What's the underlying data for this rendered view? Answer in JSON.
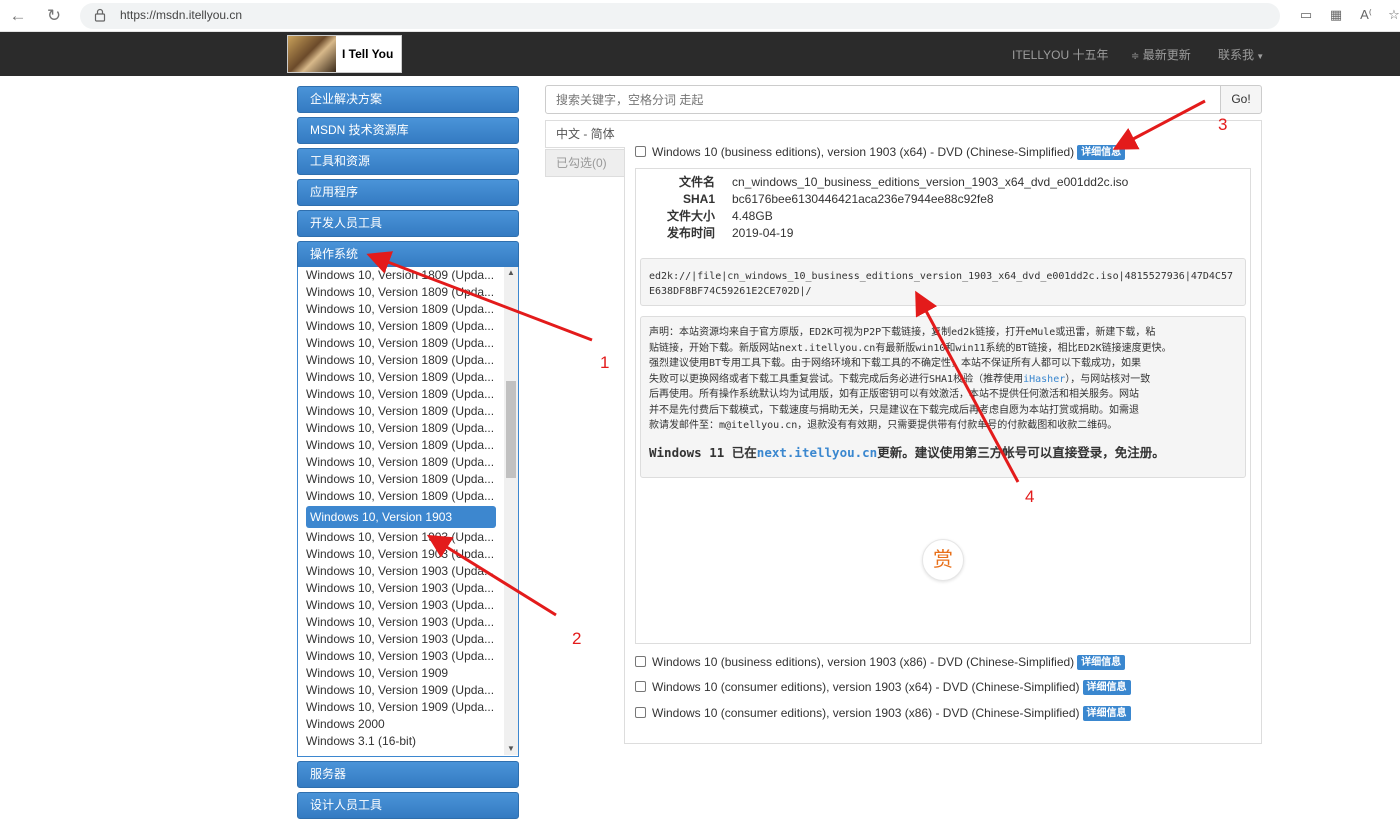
{
  "browser": {
    "url": "https://msdn.itellyou.cn"
  },
  "navbar": {
    "logo_text": "I Tell You",
    "links": [
      "ITELLYOU 十五年",
      "最新更新",
      "联系我"
    ]
  },
  "sidebar": {
    "top_items": [
      "企业解决方案",
      "MSDN 技术资源库",
      "工具和资源",
      "应用程序",
      "开发人员工具",
      "操作系统"
    ],
    "os_list": [
      "Windows 10, Version 1809 (Upda...",
      "Windows 10, Version 1809 (Upda...",
      "Windows 10, Version 1809 (Upda...",
      "Windows 10, Version 1809 (Upda...",
      "Windows 10, Version 1809 (Upda...",
      "Windows 10, Version 1809 (Upda...",
      "Windows 10, Version 1809 (Upda...",
      "Windows 10, Version 1809 (Upda...",
      "Windows 10, Version 1809 (Upda...",
      "Windows 10, Version 1809 (Upda...",
      "Windows 10, Version 1809 (Upda...",
      "Windows 10, Version 1809 (Upda...",
      "Windows 10, Version 1809 (Upda...",
      "Windows 10, Version 1809 (Upda...",
      "Windows 10, Version 1903",
      "Windows 10, Version 1903 (Upda...",
      "Windows 10, Version 1903 (Upda...",
      "Windows 10, Version 1903 (Upda...",
      "Windows 10, Version 1903 (Upda...",
      "Windows 10, Version 1903 (Upda...",
      "Windows 10, Version 1903 (Upda...",
      "Windows 10, Version 1903 (Upda...",
      "Windows 10, Version 1903 (Upda...",
      "Windows 10, Version 1909",
      "Windows 10, Version 1909 (Upda...",
      "Windows 10, Version 1909 (Upda...",
      "Windows 2000",
      "Windows 3.1 (16-bit)"
    ],
    "selected_index": 14,
    "bottom_items": [
      "服务器",
      "设计人员工具"
    ]
  },
  "search": {
    "placeholder": "搜索关键字，空格分词 走起",
    "button": "Go!"
  },
  "tabs": [
    "中文 - 简体",
    "已勾选(0)"
  ],
  "items": [
    "Windows 10 (business editions), version 1903 (x64) - DVD (Chinese-Simplified)",
    "Windows 10 (business editions), version 1903 (x86) - DVD (Chinese-Simplified)",
    "Windows 10 (consumer editions), version 1903 (x64) - DVD (Chinese-Simplified)",
    "Windows 10 (consumer editions), version 1903 (x86) - DVD (Chinese-Simplified)"
  ],
  "details_badge": "详细信息",
  "file": {
    "name_label": "文件名",
    "name": "cn_windows_10_business_editions_version_1903_x64_dvd_e001dd2c.iso",
    "sha1_label": "SHA1",
    "sha1": "bc6176bee6130446421aca236e7944ee88c92fe8",
    "size_label": "文件大小",
    "size": "4.48GB",
    "date_label": "发布时间",
    "date": "2019-04-19"
  },
  "ed2k": "ed2k://|file|cn_windows_10_business_editions_version_1903_x64_dvd_e001dd2c.iso|4815527936|47D4C57E638DF8BF74C59261E2CE702D|/",
  "notice": {
    "line1": "声明：本站资源均来自于官方原版，ED2K可视为P2P下载链接，复制ed2k链接，打开eMule或迅雷，新建下载，粘",
    "line2": "贴链接，开始下载。新版网站next.itellyou.cn有最新版win10和win11系统的BT链接，相比ED2K链接速度更快。",
    "line3": "强烈建议使用BT专用工具下载。由于网络环境和下载工具的不确定性，本站不保证所有人都可以下载成功，如果",
    "line4a": "失败可以更换网络或者下载工具重复尝试。下载完成后务必进行SHA1校验（推荐使用",
    "line4link": "iHasher",
    "line4b": "），与网站核对一致",
    "line5": "后再使用。所有操作系统默认均为试用版，如有正版密钥可以有效激活，本站不提供任何激活和相关服务。网站",
    "line6": "并不是先付费后下载模式，下载速度与捐助无关，只是建议在下载完成后再考虑自愿为本站打赏或捐助。如需退",
    "line7": "款请发邮件至：m@itellyou.cn，退款没有有效期，只需要提供带有付款单号的付款截图和收款二维码。",
    "big_a": "Windows 11 已在",
    "big_link": "next.itellyou.cn",
    "big_b": "更新。建议使用第三方帐号可以直接登录，免注册。"
  },
  "reward": "赏",
  "annotations": [
    "1",
    "2",
    "3",
    "4"
  ]
}
